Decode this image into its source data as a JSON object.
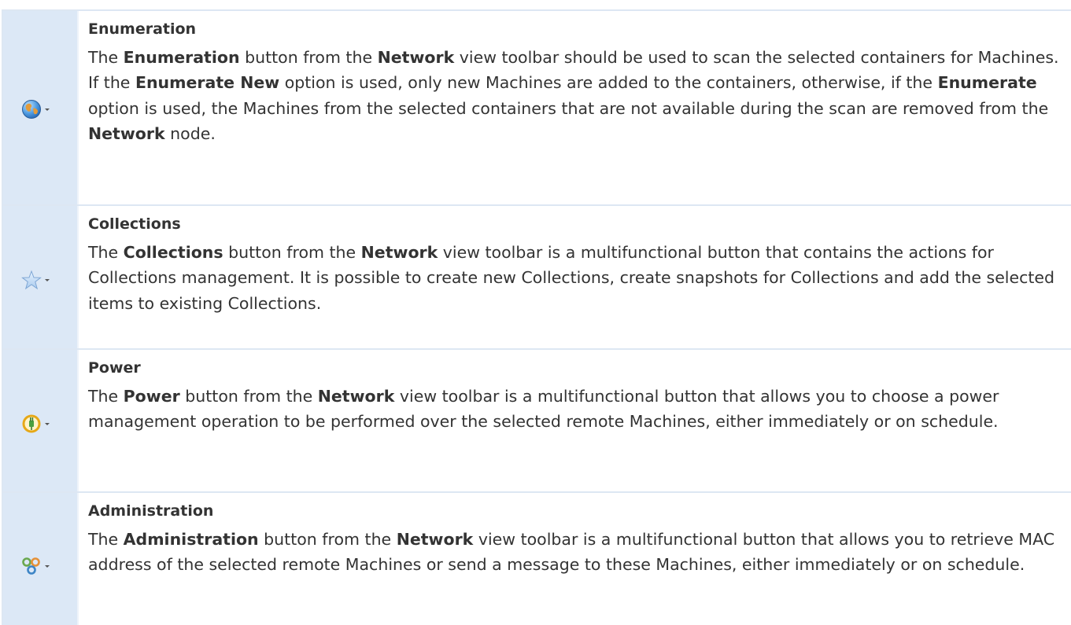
{
  "rows": [
    {
      "icon": "globe-icon",
      "title": "Enumeration",
      "segments": [
        {
          "t": "The ",
          "b": false
        },
        {
          "t": "Enumeration",
          "b": true
        },
        {
          "t": " button from the ",
          "b": false
        },
        {
          "t": "Network",
          "b": true
        },
        {
          "t": " view toolbar should be used to scan the selected containers for Machines. If the ",
          "b": false
        },
        {
          "t": "Enumerate New",
          "b": true
        },
        {
          "t": " option is used, only new Machines are added to the containers, otherwise, if the ",
          "b": false
        },
        {
          "t": "Enumerate",
          "b": true
        },
        {
          "t": " option is used, the Machines from the selected containers that are not available during the scan are removed from the ",
          "b": false
        },
        {
          "t": "Network",
          "b": true
        },
        {
          "t": " node.",
          "b": false
        }
      ]
    },
    {
      "icon": "star-icon",
      "title": "Collections",
      "segments": [
        {
          "t": "The ",
          "b": false
        },
        {
          "t": "Collections",
          "b": true
        },
        {
          "t": " button from the ",
          "b": false
        },
        {
          "t": "Network",
          "b": true
        },
        {
          "t": " view toolbar is a multifunctional button that contains the actions for Collections management. It is possible to create new Collections, create snapshots for Collections and add the selected items to existing Collections.",
          "b": false
        }
      ]
    },
    {
      "icon": "power-plug-icon",
      "title": "Power",
      "segments": [
        {
          "t": "The ",
          "b": false
        },
        {
          "t": "Power",
          "b": true
        },
        {
          "t": " button from the ",
          "b": false
        },
        {
          "t": "Network",
          "b": true
        },
        {
          "t": " view toolbar is a multifunctional button that allows you to choose a power management operation to be performed over the selected remote Machines, either immediately or on schedule.",
          "b": false
        }
      ]
    },
    {
      "icon": "gears-icon",
      "title": "Administration",
      "segments": [
        {
          "t": "The ",
          "b": false
        },
        {
          "t": "Administration",
          "b": true
        },
        {
          "t": " button from the ",
          "b": false
        },
        {
          "t": "Network",
          "b": true
        },
        {
          "t": " view toolbar is a multifunctional button that allows you to retrieve MAC address of the selected remote Machines or send a message to these Machines, either immediately or on schedule.",
          "b": false
        }
      ]
    }
  ]
}
